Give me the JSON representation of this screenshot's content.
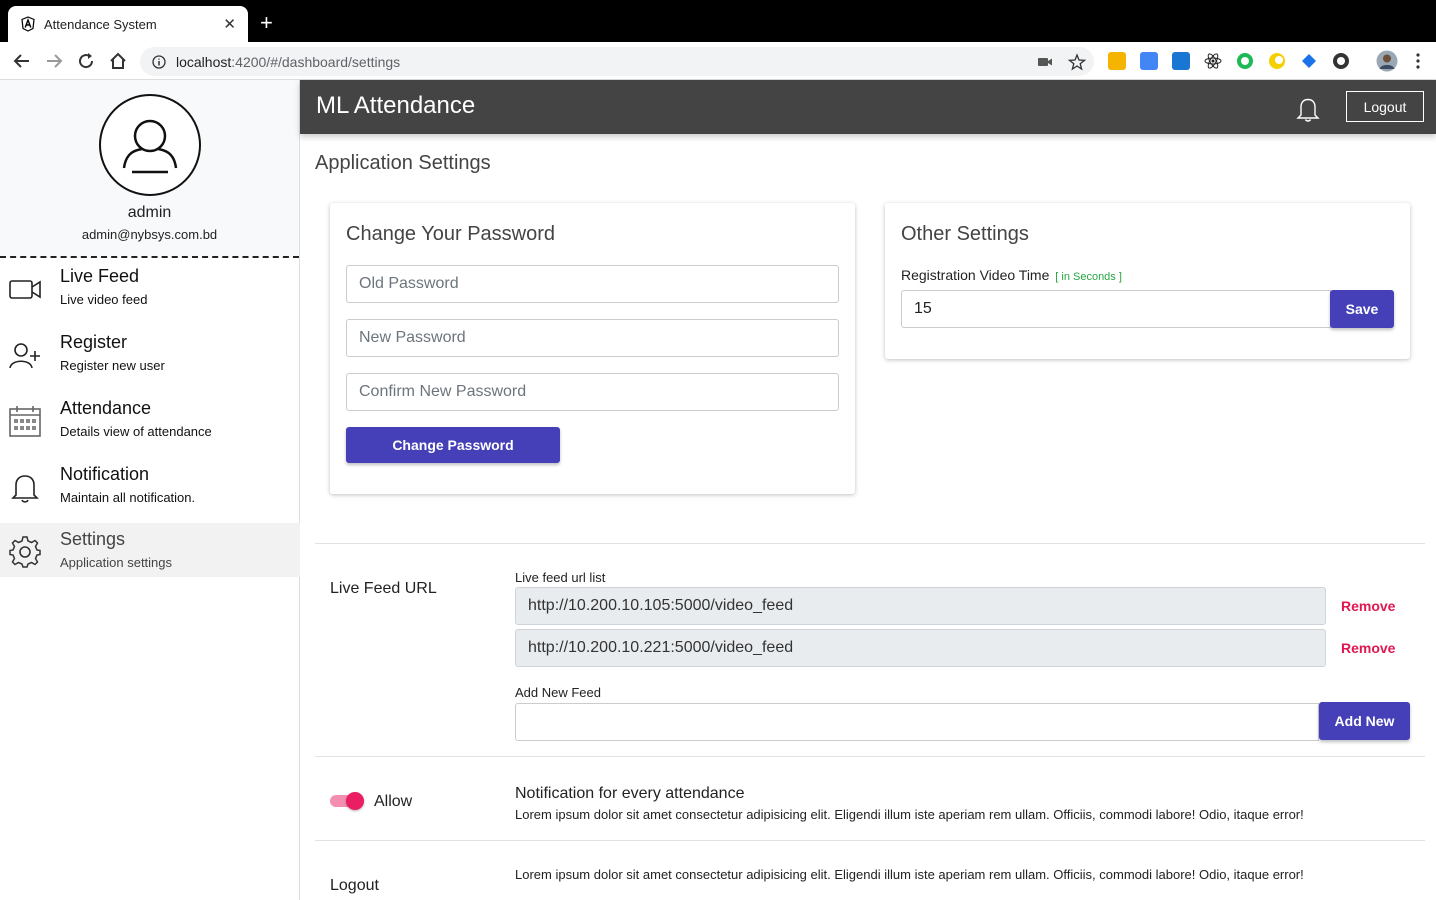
{
  "browser": {
    "tab_title": "Attendance System",
    "url_host": "localhost",
    "url_rest": ":4200/#/dashboard/settings"
  },
  "sidebar": {
    "user_name": "admin",
    "user_email": "admin@nybsys.com.bd",
    "items": [
      {
        "title": "Live Feed",
        "subtitle": "Live video feed",
        "icon": "video-camera-icon"
      },
      {
        "title": "Register",
        "subtitle": "Register new user",
        "icon": "add-user-icon"
      },
      {
        "title": "Attendance",
        "subtitle": "Details view of attendance",
        "icon": "calendar-icon"
      },
      {
        "title": "Notification",
        "subtitle": "Maintain all notification.",
        "icon": "bell-icon"
      },
      {
        "title": "Settings",
        "subtitle": "Application settings",
        "icon": "gear-icon"
      }
    ]
  },
  "header": {
    "brand": "ML Attendance",
    "logout_label": "Logout"
  },
  "page_title": "Application Settings",
  "password_card": {
    "title": "Change Your Password",
    "old_placeholder": "Old Password",
    "new_placeholder": "New Password",
    "confirm_placeholder": "Confirm New Password",
    "button_label": "Change Password"
  },
  "other_settings": {
    "title": "Other Settings",
    "label": "Registration Video Time",
    "hint": "[ in Seconds ]",
    "value": "15",
    "save_label": "Save"
  },
  "live_feed": {
    "section_label": "Live Feed URL",
    "list_label": "Live feed url list",
    "urls": [
      "http://10.200.10.105:5000/video_feed",
      "http://10.200.10.221:5000/video_feed"
    ],
    "remove_label": "Remove",
    "add_label": "Add New Feed",
    "add_value": "",
    "add_button": "Add New"
  },
  "notification_setting": {
    "toggle_label": "Allow",
    "toggle_on": true,
    "title": "Notification for every attendance",
    "description": "Lorem ipsum dolor sit amet consectetur adipisicing elit. Eligendi illum iste aperiam rem ullam. Officiis, commodi labore! Odio, itaque error!"
  },
  "logout_setting": {
    "label": "Logout",
    "description": "Lorem ipsum dolor sit amet consectetur adipisicing elit. Eligendi illum iste aperiam rem ullam. Officiis, commodi labore! Odio, itaque error!"
  },
  "colors": {
    "primary": "#4540b7",
    "header_bg": "#444444",
    "remove": "#e0184f",
    "toggle": "#e91e63",
    "hint": "#28a745"
  }
}
